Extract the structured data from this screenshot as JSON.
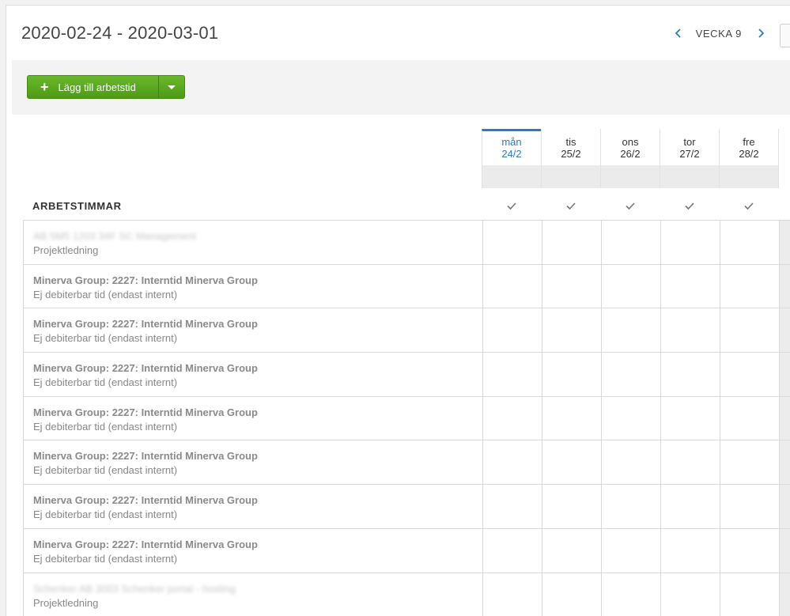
{
  "header": {
    "date_range": "2020-02-24 - 2020-03-01",
    "week_label": "VECKA 9",
    "prev_icon": "chevron-left-icon",
    "next_icon": "chevron-right-icon"
  },
  "toolbar": {
    "add_label": "Lägg till arbetstid",
    "add_icon": "plus-icon",
    "dropdown_icon": "caret-down-icon"
  },
  "days": [
    {
      "name": "mån",
      "date": "24/2",
      "active": true
    },
    {
      "name": "tis",
      "date": "25/2",
      "active": false
    },
    {
      "name": "ons",
      "date": "26/2",
      "active": false
    },
    {
      "name": "tor",
      "date": "27/2",
      "active": false
    },
    {
      "name": "fre",
      "date": "28/2",
      "active": false
    }
  ],
  "section": {
    "title": "ARBETSTIMMAR",
    "check_icon": "checkmark-icon"
  },
  "colors": {
    "accent": "#2a7bc8",
    "button_green": "#5aa91e"
  },
  "rows": [
    {
      "client": "AB 5M5 1203 34F SC",
      "project": "Management",
      "activity": "Projektledning",
      "blurred": true
    },
    {
      "client": "Minerva Group",
      "project": "2227: Interntid Minerva Group",
      "activity": "Ej debiterbar tid (endast internt)",
      "blurred": false
    },
    {
      "client": "Minerva Group",
      "project": "2227: Interntid Minerva Group",
      "activity": "Ej debiterbar tid (endast internt)",
      "blurred": false
    },
    {
      "client": "Minerva Group",
      "project": "2227: Interntid Minerva Group",
      "activity": "Ej debiterbar tid (endast internt)",
      "blurred": false
    },
    {
      "client": "Minerva Group",
      "project": "2227: Interntid Minerva Group",
      "activity": "Ej debiterbar tid (endast internt)",
      "blurred": false
    },
    {
      "client": "Minerva Group",
      "project": "2227: Interntid Minerva Group",
      "activity": "Ej debiterbar tid (endast internt)",
      "blurred": false
    },
    {
      "client": "Minerva Group",
      "project": "2227: Interntid Minerva Group",
      "activity": "Ej debiterbar tid (endast internt)",
      "blurred": false
    },
    {
      "client": "Minerva Group",
      "project": "2227: Interntid Minerva Group",
      "activity": "Ej debiterbar tid (endast internt)",
      "blurred": false
    },
    {
      "client": "Schenker AB 3003",
      "project": "Schenker portal - hosting",
      "activity": "Projektledning",
      "blurred": true
    }
  ]
}
